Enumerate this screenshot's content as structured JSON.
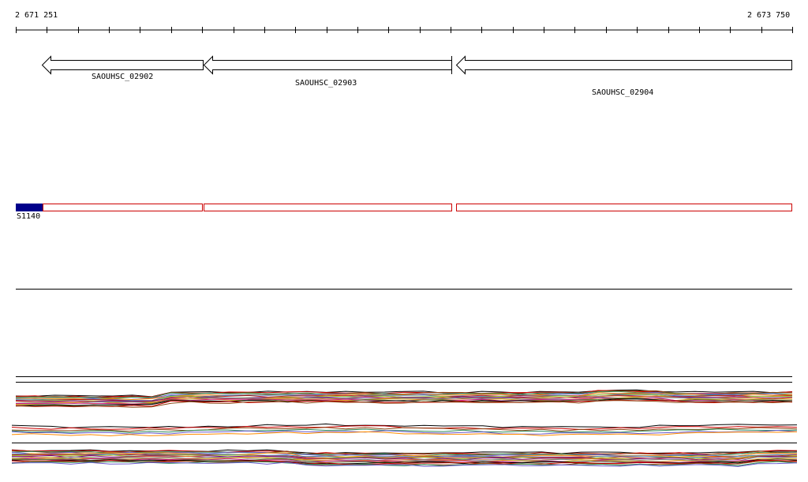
{
  "ruler": {
    "start_label": "2 671 251",
    "end_label": "2 673 750"
  },
  "genes": [
    {
      "name": "SAOUHSC_02902",
      "strand": "-"
    },
    {
      "name": "SAOUHSC_02903",
      "strand": "-"
    },
    {
      "name": "SAOUHSC_02904",
      "strand": "-"
    }
  ],
  "features": {
    "bar_label": "S1140",
    "feature_color": "#00008b",
    "outline_color": "#cc0000"
  },
  "colors": {
    "background": "#ffffff",
    "line": "#000000"
  }
}
